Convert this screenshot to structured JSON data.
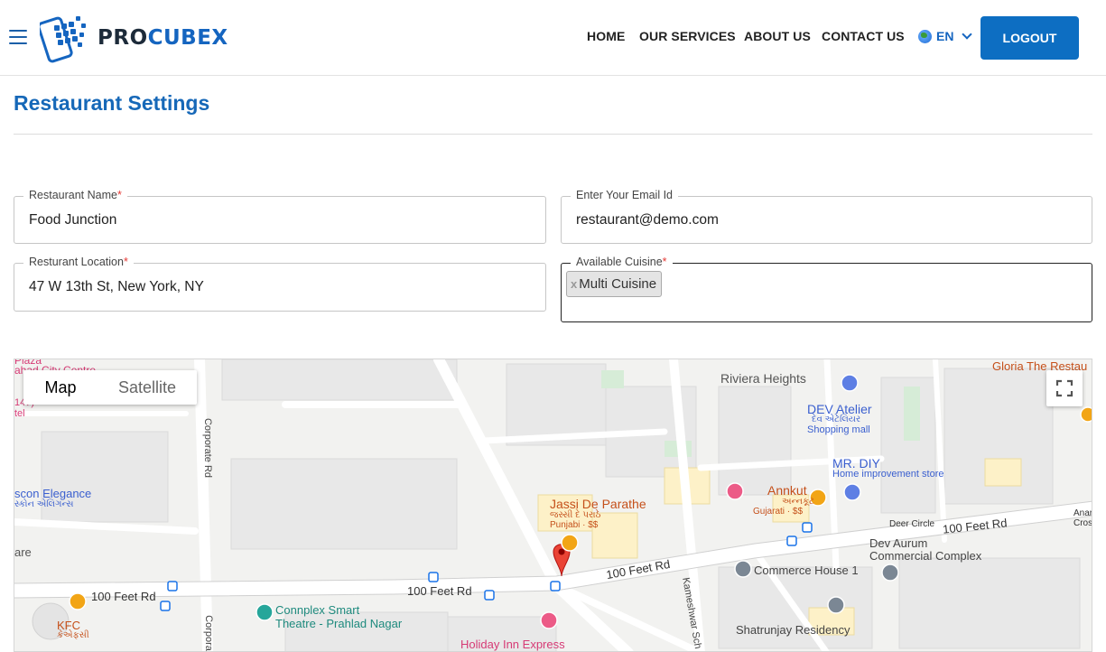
{
  "header": {
    "logo_text_a": "PRO",
    "logo_text_b": "CUBEX",
    "nav": [
      "HOME",
      "OUR SERVICES",
      "ABOUT US",
      "CONTACT US"
    ],
    "language": "EN",
    "logout_label": "LOGOUT",
    "brand_color": "#1565c0"
  },
  "page": {
    "title": "Restaurant Settings"
  },
  "form": {
    "restaurant_name": {
      "label": "Restaurant Name",
      "required_mark": "*",
      "value": "Food Junction"
    },
    "email": {
      "label": "Enter Your Email Id",
      "value": "restaurant@demo.com"
    },
    "location": {
      "label": "Resturant Location",
      "required_mark": "*",
      "value": "47 W 13th St, New York, NY"
    },
    "cuisine": {
      "label": "Available Cuisine",
      "required_mark": "*",
      "remove_mark": "x",
      "selected": [
        "Multi Cuisine"
      ]
    }
  },
  "map": {
    "view_toggle": [
      "Map",
      "Satellite"
    ],
    "labels": {
      "riviera": "Riviera Heights",
      "gloria": "Gloria The Restau",
      "dev_atelier": "DEV Atelier",
      "dev_atelier_native": "દેવ એટેલિયર",
      "dev_atelier_type": "Shopping mall",
      "mr_diy": "MR. DIY",
      "mr_diy_type": "Home improvement store",
      "jassi": "Jassi De Parathe",
      "jassi_native": "જસ્સી દે પરાઠે",
      "jassi_type": "Punjabi · $$",
      "annkut": "Annkut",
      "annkut_native": "અન્નકૂટ",
      "annkut_type": "Gujarati · $$",
      "deer_circle": "Deer Circle",
      "road_100_a": "100 Feet Rd",
      "road_100_b": "100 Feet Rd",
      "road_100_c": "100 Feet Rd",
      "road_100_d": "100 Feet Rd",
      "dev_aurum": "Dev Aurum",
      "dev_aurum_2": "Commercial Complex",
      "commerce_house": "Commerce House 1",
      "shatrunjay": "Shatrunjay Residency",
      "connplex_1": "Connplex Smart",
      "connplex_2": "Theatre - Prahlad Nagar",
      "holiday_inn": "Holiday Inn Express",
      "kfc": "KFC",
      "kfc_native": "કેએફસી",
      "corporate_rd": "Corporate Rd",
      "corporate_rd_2": "Corpora",
      "kameshwar": "Kameshwar Sch",
      "elegance": "scon Elegance",
      "elegance_native": "સ્કોન એલિગન્સ",
      "left_fragment_1": "Plaza",
      "left_fragment_2": "ahad City Centre",
      "left_fragment_3": "147)",
      "left_fragment_4": "tel",
      "left_fragment_5": "are",
      "right_fragment_1": "Anar",
      "right_fragment_2": "Cros"
    }
  }
}
